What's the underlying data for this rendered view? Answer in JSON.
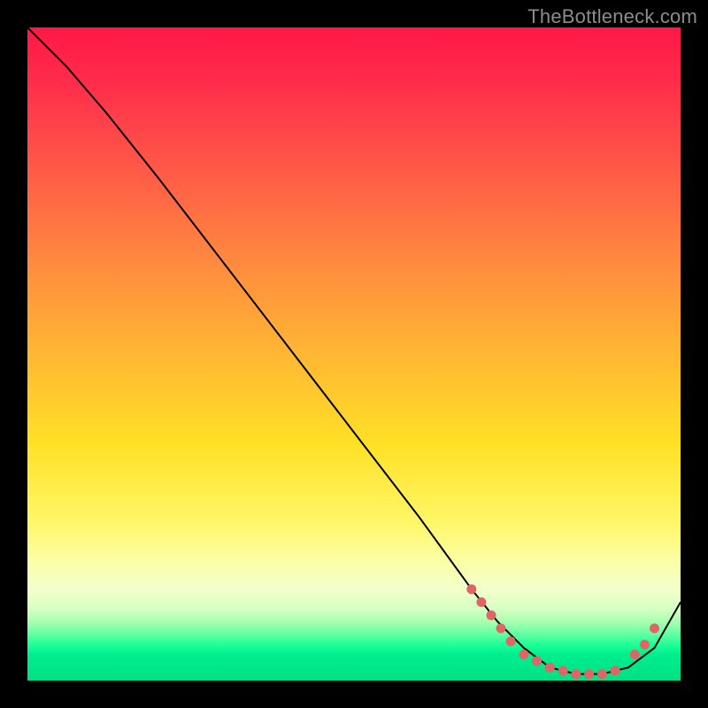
{
  "watermark": "TheBottleneck.com",
  "colors": {
    "dot": "#e06666",
    "curve": "#000000"
  },
  "chart_data": {
    "type": "line",
    "title": "",
    "xlabel": "",
    "ylabel": "",
    "xlim": [
      0,
      100
    ],
    "ylim": [
      0,
      100
    ],
    "grid": false,
    "legend": false,
    "description": "Bottleneck-percentage style curve over a red→green vertical gradient",
    "series": [
      {
        "name": "bottleneck-curve",
        "x": [
          0,
          6,
          12,
          20,
          30,
          40,
          50,
          60,
          68,
          72,
          76,
          80,
          84,
          88,
          92,
          96,
          100
        ],
        "y": [
          100,
          94,
          87,
          77,
          64,
          51,
          38,
          25,
          14,
          9,
          5,
          2,
          1,
          1,
          2,
          5,
          12
        ]
      }
    ],
    "points": [
      {
        "x": 68,
        "y": 14
      },
      {
        "x": 69.5,
        "y": 12
      },
      {
        "x": 71,
        "y": 10
      },
      {
        "x": 72.5,
        "y": 8
      },
      {
        "x": 74,
        "y": 6
      },
      {
        "x": 76,
        "y": 4
      },
      {
        "x": 78,
        "y": 3
      },
      {
        "x": 80,
        "y": 2
      },
      {
        "x": 82,
        "y": 1.5
      },
      {
        "x": 84,
        "y": 1
      },
      {
        "x": 86,
        "y": 1
      },
      {
        "x": 88,
        "y": 1
      },
      {
        "x": 90,
        "y": 1.5
      },
      {
        "x": 93,
        "y": 4
      },
      {
        "x": 94.5,
        "y": 5.5
      },
      {
        "x": 96,
        "y": 8
      }
    ]
  }
}
